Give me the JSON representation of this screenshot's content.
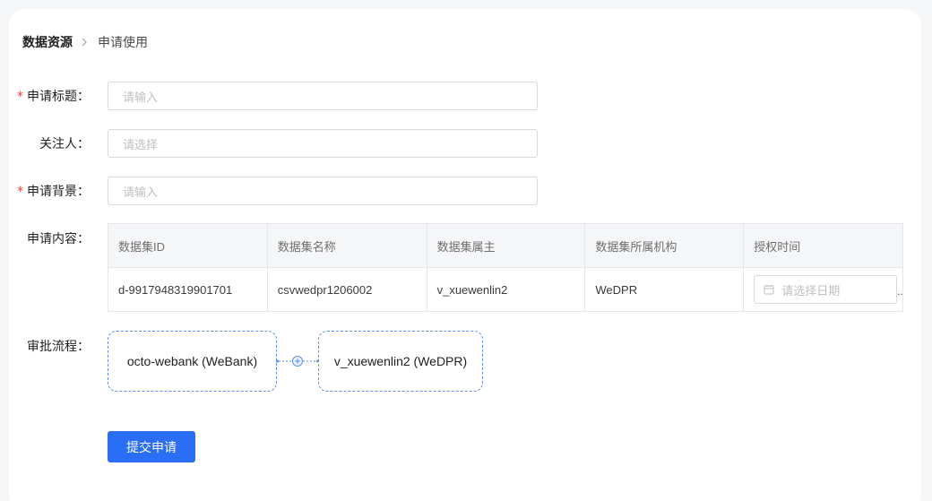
{
  "breadcrumb": {
    "root": "数据资源",
    "current": "申请使用"
  },
  "form": {
    "title": {
      "label": "申请标题：",
      "required": "*",
      "placeholder": "请输入"
    },
    "follower": {
      "label": "关注人：",
      "placeholder": "请选择"
    },
    "background": {
      "label": "申请背景：",
      "required": "*",
      "placeholder": "请输入"
    },
    "content": {
      "label": "申请内容：",
      "columns": [
        "数据集ID",
        "数据集名称",
        "数据集属主",
        "数据集所属机构",
        "授权时间"
      ],
      "rows": [
        {
          "id": "d-9917948319901701",
          "name": "csvwedpr1206002",
          "owner": "v_xuewenlin2",
          "org": "WeDPR",
          "date_placeholder": "请选择日期"
        }
      ]
    },
    "approval": {
      "label": "审批流程：",
      "nodes": [
        "octo-webank (WeBank)",
        "v_xuewenlin2 (WeDPR)"
      ]
    },
    "submit_label": "提交申请"
  },
  "colors": {
    "primary": "#2b6ef6",
    "required": "#f04141",
    "flow_border": "#5b8fe8"
  },
  "icons": [
    "chevron-right-icon",
    "calendar-icon",
    "add-node-icon"
  ]
}
